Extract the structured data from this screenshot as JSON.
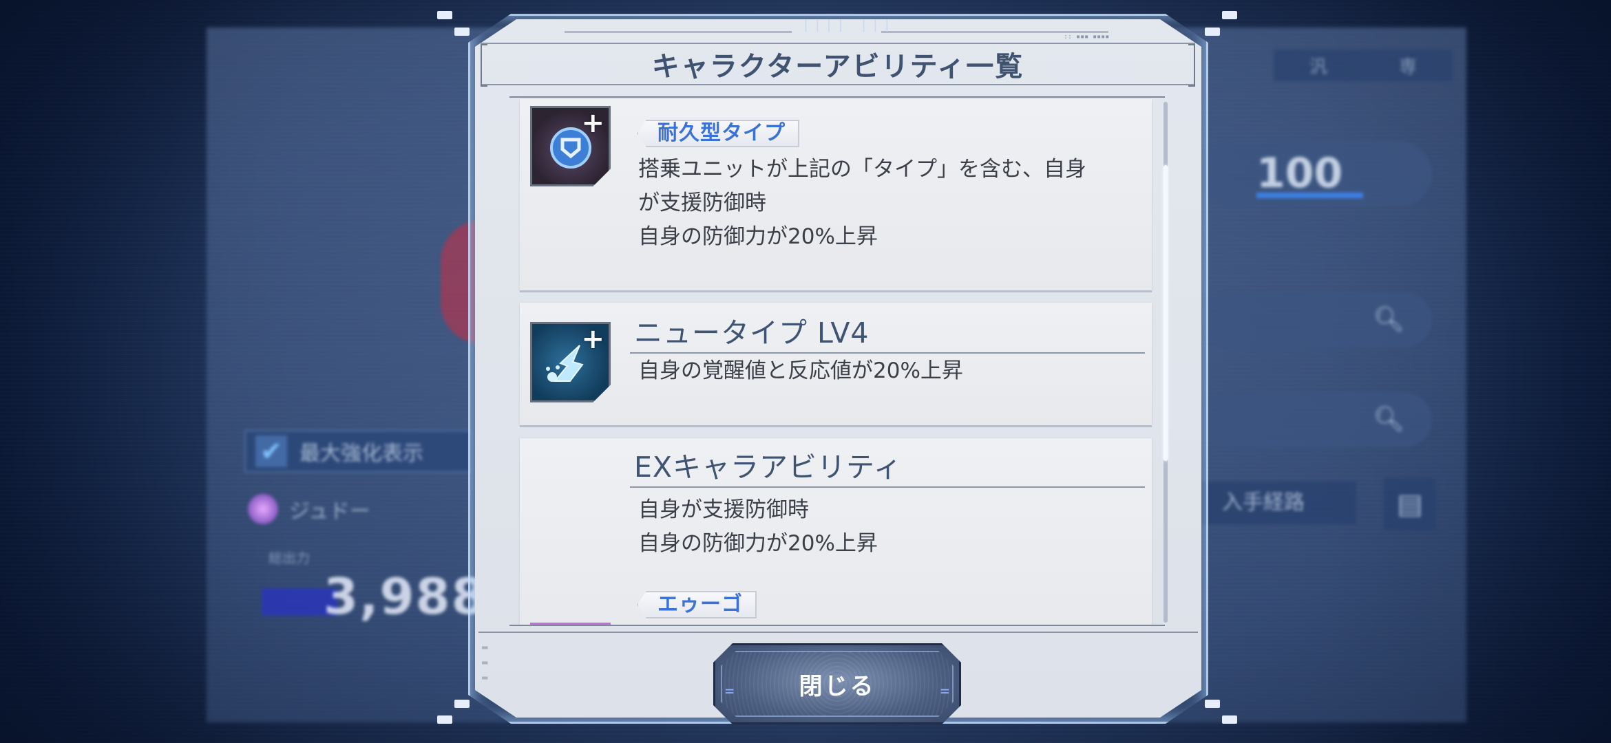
{
  "background": {
    "checkbox_label": "最大強化表示",
    "character_name": "ジュドー",
    "stat_label": "総出力",
    "power_value": "3,988",
    "level_value": "100",
    "top_tabs": [
      "汎",
      "専"
    ],
    "acquire_label": "入手経路"
  },
  "dialog": {
    "title": "キャラクターアビリティ一覧",
    "abilities": [
      {
        "icon": "durable-type-shield-icon",
        "tag": "耐久型タイプ",
        "lines": [
          "搭乗ユニットが上記の「タイプ」を含む、自身",
          "が支援防御時",
          "自身の防御力が20%上昇"
        ]
      },
      {
        "icon": "newtype-icon",
        "heading": "ニュータイプ LV4",
        "lines": [
          "自身の覚醒値と反応値が20%上昇"
        ]
      },
      {
        "heading": "EXキャラアビリティ",
        "lines": [
          "自身が支援防御時",
          "自身の防御力が20%上昇"
        ],
        "next_tag": "エゥーゴ"
      }
    ],
    "close_label": "閉じる"
  },
  "colors": {
    "title_text": "#3f526f",
    "tag_text": "#3a72d8",
    "body_text": "#3a3f48",
    "frame_glow": "#c8e1ff"
  }
}
